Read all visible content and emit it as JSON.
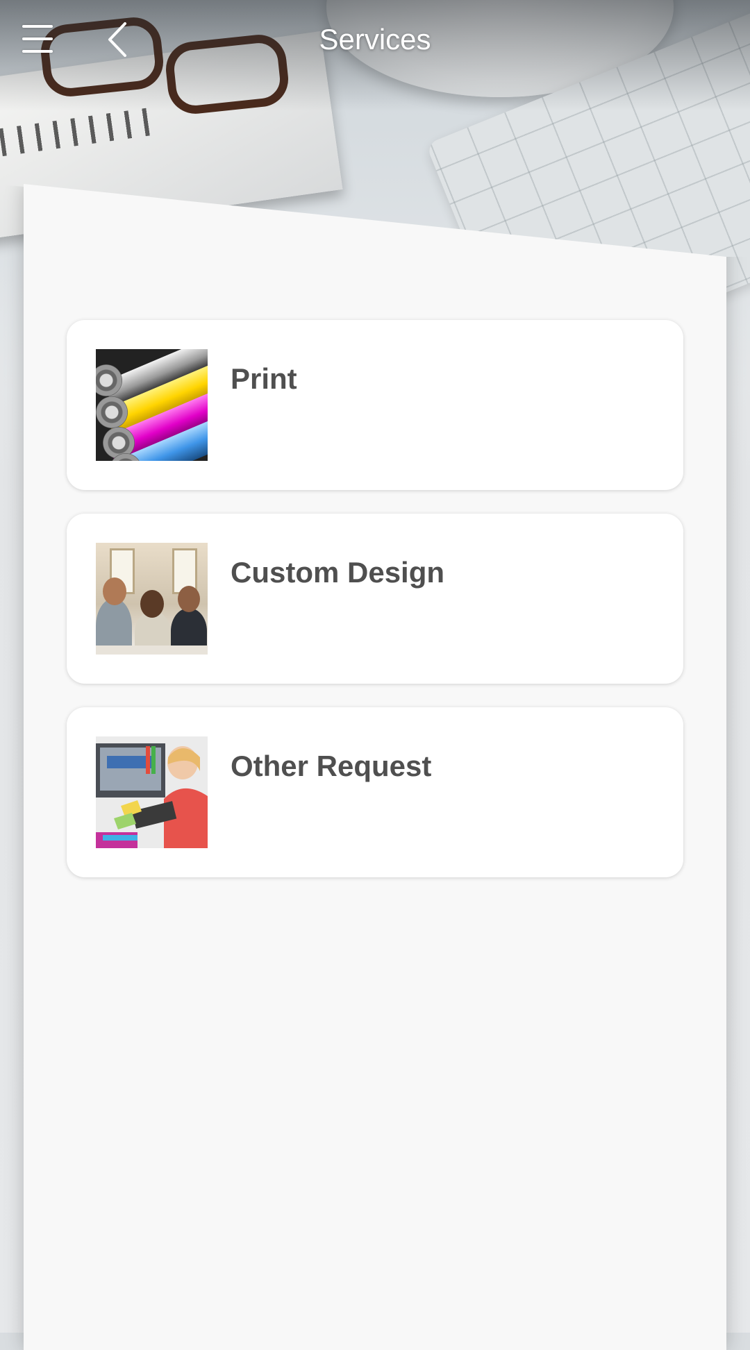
{
  "header": {
    "title": "Services",
    "menu_icon": "hamburger-menu-icon",
    "back_icon": "chevron-left-icon"
  },
  "services": [
    {
      "label": "Print",
      "image": "printing-rollers-photo"
    },
    {
      "label": "Custom Design",
      "image": "design-team-photo"
    },
    {
      "label": "Other Request",
      "image": "designer-at-desk-photo"
    }
  ],
  "colors": {
    "title_text": "#ffffff",
    "card_background": "#ffffff",
    "card_label": "#4f4f4f",
    "panel_background": "#f8f8f8"
  }
}
